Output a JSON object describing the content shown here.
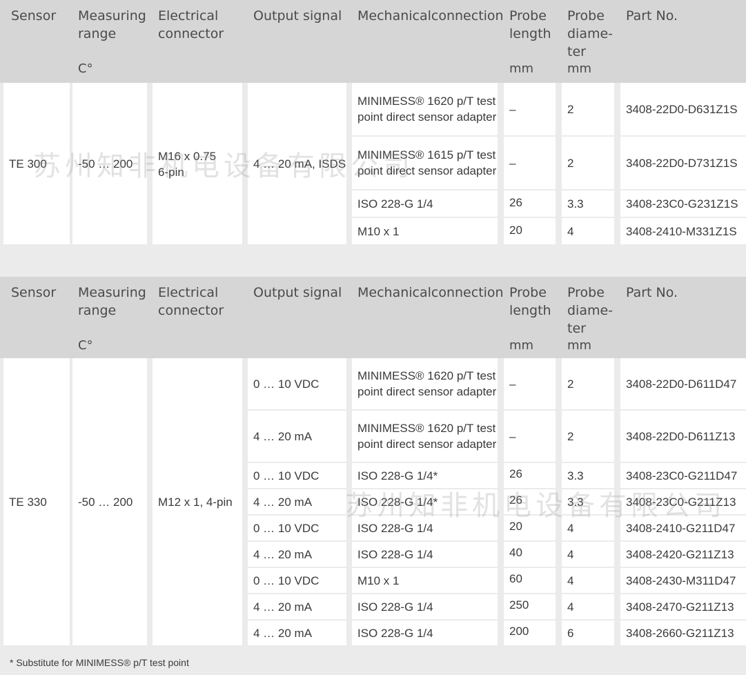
{
  "headers": {
    "sensor": "Sensor",
    "range": "Measuring\nrange",
    "range_unit": "C°",
    "connector": "Electrical\nconnector",
    "output": "Output signal",
    "mech": "Mechanicalconnection",
    "length": "Probe\nlength",
    "length_unit": "mm",
    "diameter": "Probe\ndiame-\nter",
    "diameter_unit": "mm",
    "part": "Part No."
  },
  "table1": {
    "sensor": "TE 300",
    "range": "-50 … 200",
    "connector": "M16 x 0.75\n6-pin",
    "output": "4 … 20 mA, ISDS",
    "rows": [
      {
        "mech": "MINIMESS® 1620 p/T test\npoint direct sensor adapter",
        "length": "–",
        "diameter": "2",
        "part": "3408-22D0-D631Z1S"
      },
      {
        "mech": "MINIMESS® 1615 p/T test\npoint direct sensor adapter",
        "length": "–",
        "diameter": "2",
        "part": "3408-22D0-D731Z1S"
      },
      {
        "mech": "ISO 228-G 1/4",
        "length": "26",
        "diameter": "3.3",
        "part": "3408-23C0-G231Z1S"
      },
      {
        "mech": "M10 x 1",
        "length": "20",
        "diameter": "4",
        "part": "3408-2410-M331Z1S"
      }
    ]
  },
  "table2": {
    "sensor": "TE 330",
    "range": "-50 … 200",
    "connector": "M12 x 1, 4-pin",
    "rows": [
      {
        "output": "0 … 10 VDC",
        "mech": "MINIMESS® 1620 p/T test\npoint direct sensor adapter",
        "length": "–",
        "diameter": "2",
        "part": "3408-22D0-D611D47"
      },
      {
        "output": "4 … 20 mA",
        "mech": "MINIMESS® 1620 p/T test\npoint direct sensor adapter",
        "length": "–",
        "diameter": "2",
        "part": "3408-22D0-D611Z13"
      },
      {
        "output": "0 … 10 VDC",
        "mech": "ISO 228-G 1/4*",
        "length": "26",
        "diameter": "3.3",
        "part": "3408-23C0-G211D47"
      },
      {
        "output": "4 … 20 mA",
        "mech": "ISO 228-G 1/4*",
        "length": "26",
        "diameter": "3.3",
        "part": "3408-23C0-G211Z13"
      },
      {
        "output": "0 … 10 VDC",
        "mech": "ISO 228-G 1/4",
        "length": "20",
        "diameter": "4",
        "part": "3408-2410-G211D47"
      },
      {
        "output": "4 … 20 mA",
        "mech": "ISO 228-G 1/4",
        "length": "40",
        "diameter": "4",
        "part": "3408-2420-G211Z13"
      },
      {
        "output": "0 … 10 VDC",
        "mech": "M10 x 1",
        "length": "60",
        "diameter": "4",
        "part": "3408-2430-M311D47"
      },
      {
        "output": "4 … 20 mA",
        "mech": "ISO 228-G 1/4",
        "length": "250",
        "diameter": "4",
        "part": "3408-2470-G211Z13"
      },
      {
        "output": "4 … 20 mA",
        "mech": "ISO 228-G 1/4",
        "length": "200",
        "diameter": "6",
        "part": "3408-2660-G211Z13"
      }
    ]
  },
  "footnote": "* Substitute for MINIMESS® p/T test point",
  "watermark": "苏州知非机电设备有限公司"
}
